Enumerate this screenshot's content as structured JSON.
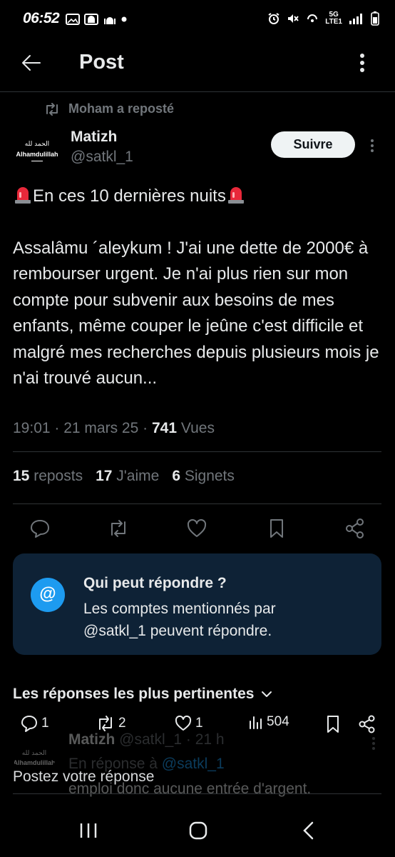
{
  "status_bar": {
    "time": "06:52",
    "network_top": "5G",
    "network_bottom": "LTE1"
  },
  "header": {
    "title": "Post"
  },
  "repost_line": "Moham a reposté",
  "author": {
    "avatar_arabic": "الحمد لله",
    "avatar_latin": "Alhamdulillah",
    "name": "Matizh",
    "handle": "@satkl_1"
  },
  "follow_label": "Suivre",
  "tweet": {
    "line1": "En ces 10 dernières nuits",
    "body": "Assalâmu ´aleykum ! J'ai une dette de 2000€ à rembourser urgent. Je n'ai plus rien sur mon compte pour subvenir aux besoins de mes enfants, même couper le jeûne c'est difficile et malgré mes recherches depuis plusieurs mois je n'ai trouvé aucun...",
    "time": "19:01",
    "date": "21 mars 25",
    "views_count": "741",
    "views_label": "Vues"
  },
  "stats": {
    "reposts_count": "15",
    "reposts_label": "reposts",
    "likes_count": "17",
    "likes_label": "J'aime",
    "bookmarks_count": "6",
    "bookmarks_label": "Signets"
  },
  "reply_card": {
    "icon": "@",
    "title": "Qui peut répondre ?",
    "text": "Les comptes mentionnés par @satkl_1 peuvent répondre."
  },
  "best_replies_label": "Les réponses les plus pertinentes",
  "reply_stats": {
    "replies": "1",
    "reposts": "2",
    "likes": "1",
    "views": "504"
  },
  "reply": {
    "name": "Matizh",
    "handle": "@satkl_1",
    "age": "21 h",
    "in_reply_prefix": "En réponse à",
    "in_reply_handle": "@satkl_1",
    "text": "emploi donc aucune entrée d'argent."
  },
  "compose_placeholder": "Postez votre réponse",
  "colors": {
    "accent": "#1d9bf0",
    "card_bg": "#0e2236",
    "muted": "#71767b"
  }
}
